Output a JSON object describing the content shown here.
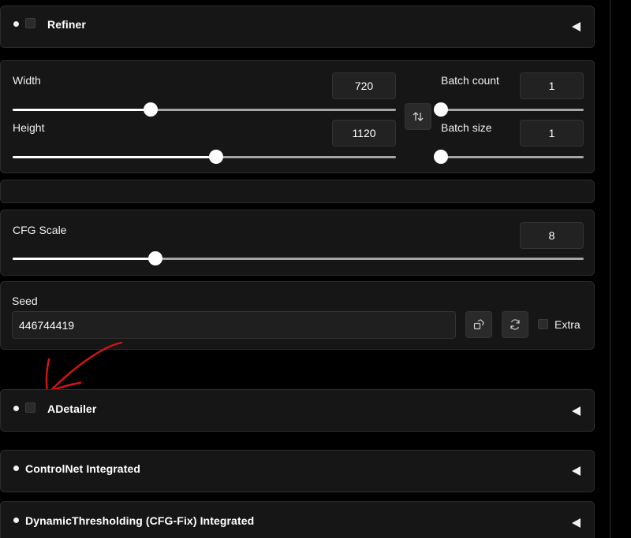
{
  "accordions": {
    "refiner": {
      "title": "Refiner"
    },
    "adetailer": {
      "title": "ADetailer"
    },
    "controlnet": {
      "title": "ControlNet Integrated"
    },
    "dynthresh": {
      "title": "DynamicThresholding (CFG-Fix) Integrated"
    }
  },
  "dimensions": {
    "width": {
      "label": "Width",
      "value": "720",
      "fraction": 0.36
    },
    "height": {
      "label": "Height",
      "value": "1120",
      "fraction": 0.53
    }
  },
  "batch": {
    "count": {
      "label": "Batch count",
      "value": "1",
      "fraction": 0.0
    },
    "size": {
      "label": "Batch size",
      "value": "1",
      "fraction": 0.0
    }
  },
  "cfg": {
    "label": "CFG Scale",
    "value": "8",
    "fraction": 0.25
  },
  "seed": {
    "label": "Seed",
    "value": "446744419",
    "extra_label": "Extra"
  },
  "annotation": {
    "color": "#d41414"
  }
}
